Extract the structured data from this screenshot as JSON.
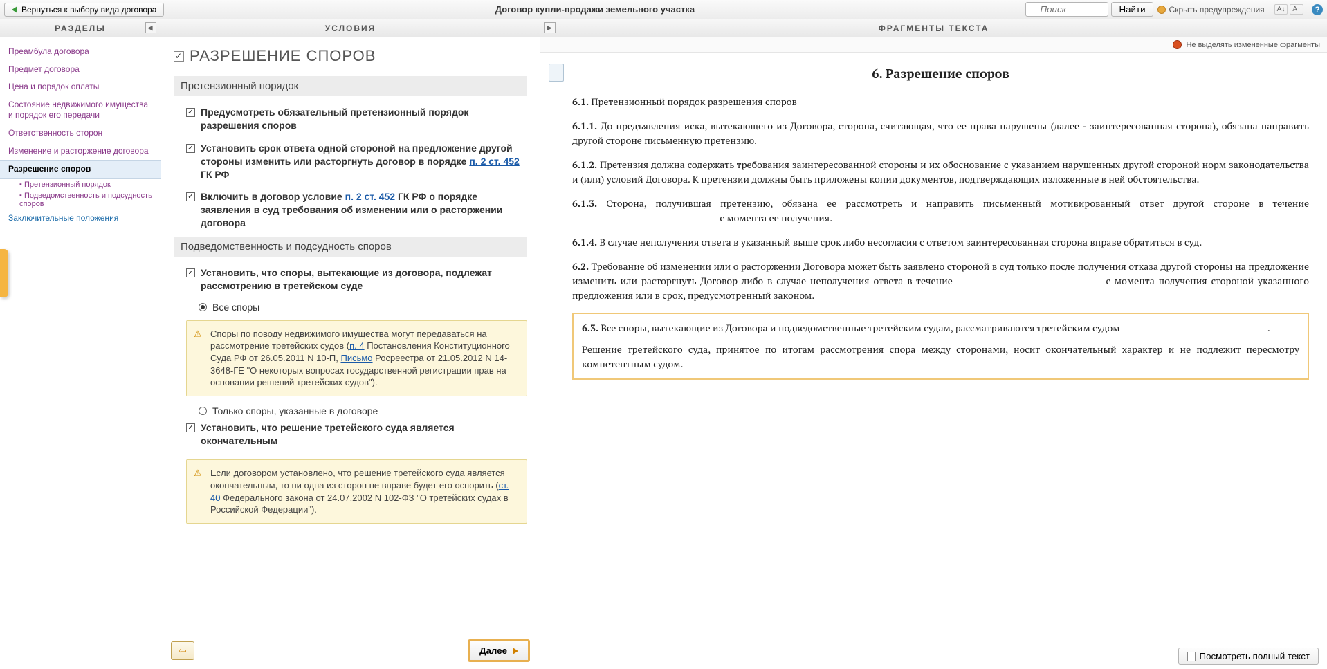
{
  "toolbar": {
    "back_label": "Вернуться к выбору вида договора",
    "title": "Договор купли-продажи земельного участка",
    "search_placeholder": "Поиск",
    "find_label": "Найти",
    "warnings_label": "Скрыть предупреждения"
  },
  "panels": {
    "left_title": "РАЗДЕЛЫ",
    "mid_title": "УСЛОВИЯ",
    "right_title": "ФРАГМЕНТЫ ТЕКСТА"
  },
  "nav": {
    "items": [
      "Преамбула договора",
      "Предмет договора",
      "Цена и порядок оплаты",
      "Состояние недвижимого имущества и порядок его передачи",
      "Ответственность сторон",
      "Изменение и расторжение договора"
    ],
    "active": "Разрешение споров",
    "subs": [
      "Претензионный порядок",
      "Подведомственность и подсудность споров"
    ],
    "last": "Заключительные положения"
  },
  "cond": {
    "heading": "РАЗРЕШЕНИЕ СПОРОВ",
    "sec1": "Претензионный порядок",
    "opt1": "Предусмотреть обязательный претензионный порядок разрешения споров",
    "opt2a": "Установить срок ответа одной стороной на предложение другой стороны изменить или расторгнуть договор в порядке ",
    "opt2link": "п. 2 ст. 452",
    "opt2b": " ГК РФ",
    "opt3a": "Включить в договор условие ",
    "opt3link": "п. 2 ст. 452",
    "opt3b": " ГК РФ о порядке заявления в суд требования об изменении или о расторжении договора",
    "sec2": "Подведомственность и подсудность споров",
    "opt4": "Установить, что споры, вытекающие из договора, подлежат рассмотрению в третейском суде",
    "r1": "Все споры",
    "r2": "Только споры, указанные в договоре",
    "warn1a": "Споры по поводу недвижимого имущества могут передаваться на рассмотрение третейских судов (",
    "warn1link1": "п. 4",
    "warn1b": " Постановления Конституционного Суда РФ от 26.05.2011 N 10-П, ",
    "warn1link2": "Письмо",
    "warn1c": " Росреестра от 21.05.2012 N 14-3648-ГЕ \"О некоторых вопросах государственной регистрации прав на основании решений третейских судов\").",
    "opt5": "Установить, что решение третейского суда является окончательным",
    "warn2a": "Если договором установлено, что решение третейского суда является окончательным, то ни одна из сторон не вправе будет его оспорить (",
    "warn2link": "ст. 40",
    "warn2b": " Федерального закона от 24.07.2002 N 102-ФЗ \"О третейских судах в Российской Федерации\").",
    "next": "Далее"
  },
  "doc": {
    "hl_toggle": "Не выделять измененные фрагменты",
    "title_num": "6.",
    "title": " Разрешение споров",
    "p61": "Претензионный порядок разрешения споров",
    "p611": "До предъявления иска, вытекающего из Договора, сторона, считающая, что ее права нарушены (далее - заинтересованная сторона), обязана направить другой стороне письменную претензию.",
    "p612": "Претензия должна содержать требования заинтересованной стороны и их обоснование с указанием нарушенных другой стороной норм законодательства и (или) условий Договора. К претензии должны быть приложены копии документов, подтверждающих изложенные в ней обстоятельства.",
    "p613a": "Сторона, получившая претензию, обязана ее рассмотреть и направить письменный мотивированный ответ другой стороне в течение ",
    "p613b": " с момента ее получения.",
    "p614": "В случае неполучения ответа в указанный выше срок либо несогласия с ответом заинтересованная сторона вправе обратиться в суд.",
    "p62a": "Требование об изменении или о расторжении Договора может быть заявлено стороной в суд только после получения отказа другой стороны на предложение изменить или расторгнуть Договор либо в случае неполучения ответа в течение ",
    "p62b": " с момента получения стороной указанного предложения или в срок, предусмотренный законом.",
    "p63a": "Все споры, вытекающие из Договора и подведомственные третейским судам, рассматриваются третейским судом ",
    "p63dot": ".",
    "p63b": "Решение третейского суда, принятое по итогам рассмотрения спора между сторонами, носит окончательный характер и не подлежит пересмотру компетентным судом.",
    "full_btn": "Посмотреть полный текст"
  }
}
